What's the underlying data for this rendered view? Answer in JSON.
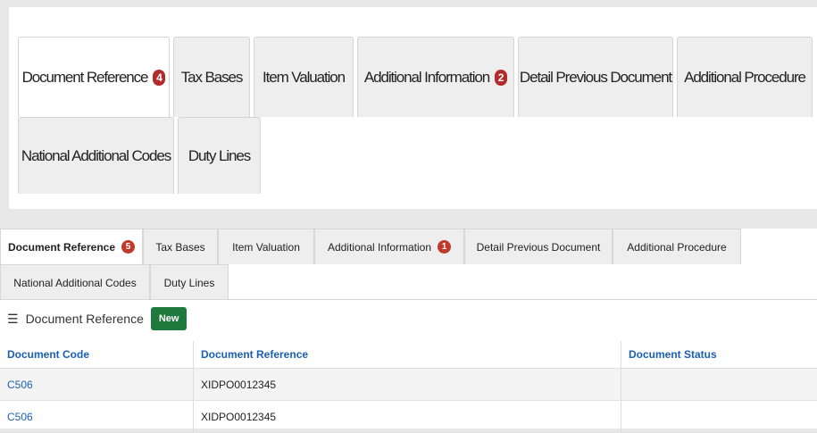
{
  "zoom_tabs": {
    "row1": [
      {
        "label": "Document Reference",
        "badge": "4"
      },
      {
        "label": "Tax Bases"
      },
      {
        "label": "Item Valuation"
      },
      {
        "label": "Additional Information",
        "badge": "2"
      },
      {
        "label": "Detail Previous Document"
      },
      {
        "label": "Additional Procedure"
      }
    ],
    "row2": [
      {
        "label": "National Additional Codes"
      },
      {
        "label": "Duty Lines"
      }
    ]
  },
  "tabs": {
    "row1": [
      {
        "label": "Document Reference",
        "badge": "5"
      },
      {
        "label": "Tax Bases"
      },
      {
        "label": "Item Valuation"
      },
      {
        "label": "Additional Information",
        "badge": "1"
      },
      {
        "label": "Detail Previous Document"
      },
      {
        "label": "Additional Procedure"
      }
    ],
    "row2": [
      {
        "label": "National Additional Codes"
      },
      {
        "label": "Duty Lines"
      }
    ]
  },
  "section": {
    "title": "Document Reference",
    "new_label": "New"
  },
  "table": {
    "headers": [
      "Document Code",
      "Document Reference",
      "Document Status"
    ],
    "rows": [
      [
        "C506",
        "XIDPO0012345",
        ""
      ],
      [
        "C506",
        "XIDPO0012345",
        ""
      ]
    ]
  },
  "colors": {
    "badge": "#c0392b",
    "new_button": "#1e7a3c",
    "link": "#1a5fb4"
  }
}
